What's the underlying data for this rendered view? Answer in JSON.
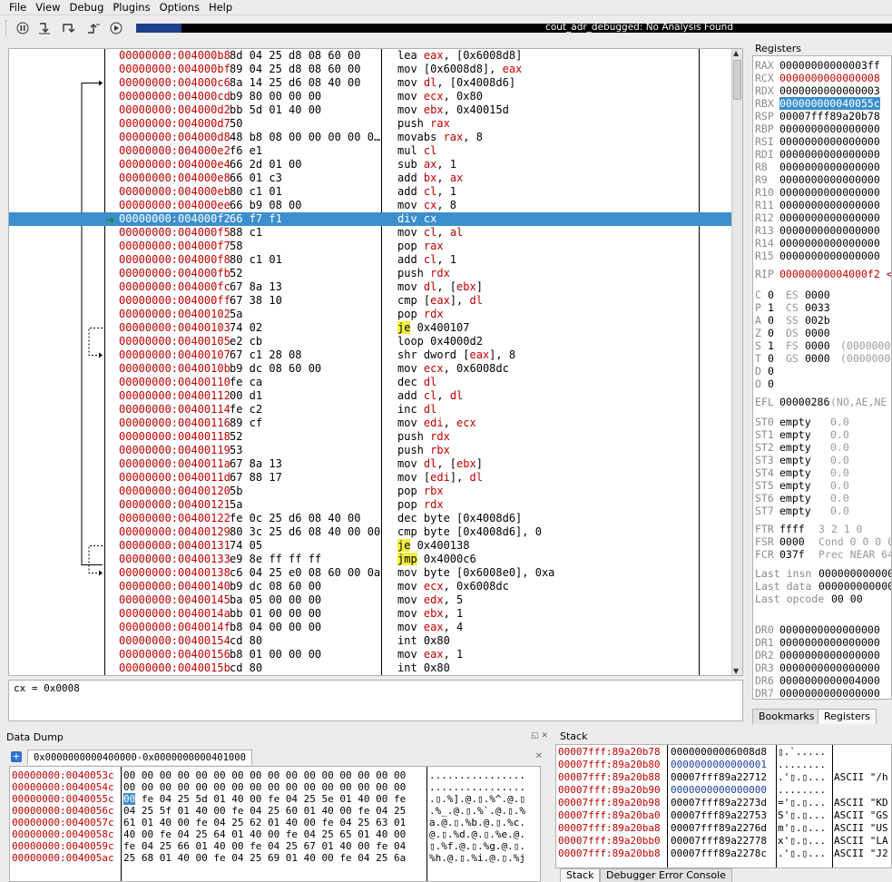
{
  "menu": [
    "File",
    "View",
    "Debug",
    "Plugins",
    "Options",
    "Help"
  ],
  "toolbar": {
    "icons": [
      "pause-icon",
      "step-into-icon",
      "step-over-icon",
      "step-out-icon",
      "run-icon"
    ]
  },
  "progress": {
    "text": "cout_adr_debugged: No Analysis Found",
    "fraction": 0.06
  },
  "disasm": [
    {
      "addr": "00000000:004000b8",
      "bytes": "8d 04 25 d8 08 60 00",
      "instr": [
        {
          "t": "lea "
        },
        {
          "t": "eax",
          "r": 1
        },
        {
          "t": ", [0x6008d8]"
        }
      ]
    },
    {
      "addr": "00000000:004000bf",
      "bytes": "89 04 25 d8 08 60 00",
      "instr": [
        {
          "t": "mov [0x6008d8], "
        },
        {
          "t": "eax",
          "r": 1
        }
      ]
    },
    {
      "addr": "00000000:004000c6",
      "bytes": "8a 14 25 d6 08 40 00",
      "instr": [
        {
          "t": "mov "
        },
        {
          "t": "dl",
          "r": 1
        },
        {
          "t": ", [0x4008d6]"
        }
      ]
    },
    {
      "addr": "00000000:004000cd",
      "bytes": "b9 80 00 00 00",
      "instr": [
        {
          "t": "mov "
        },
        {
          "t": "ecx",
          "r": 1
        },
        {
          "t": ", 0x80"
        }
      ]
    },
    {
      "addr": "00000000:004000d2",
      "bytes": "bb 5d 01 40 00",
      "instr": [
        {
          "t": "mov "
        },
        {
          "t": "ebx",
          "r": 1
        },
        {
          "t": ", 0x40015d"
        }
      ]
    },
    {
      "addr": "00000000:004000d7",
      "bytes": "50",
      "instr": [
        {
          "t": "push "
        },
        {
          "t": "rax",
          "r": 1
        }
      ]
    },
    {
      "addr": "00000000:004000d8",
      "bytes": "48 b8 08 00 00 00 00 0…",
      "instr": [
        {
          "t": "movabs "
        },
        {
          "t": "rax",
          "r": 1
        },
        {
          "t": ", 8"
        }
      ]
    },
    {
      "addr": "00000000:004000e2",
      "bytes": "f6 e1",
      "instr": [
        {
          "t": "mul "
        },
        {
          "t": "cl",
          "r": 1
        }
      ]
    },
    {
      "addr": "00000000:004000e4",
      "bytes": "66 2d 01 00",
      "instr": [
        {
          "t": "sub "
        },
        {
          "t": "ax",
          "r": 1
        },
        {
          "t": ", 1"
        }
      ]
    },
    {
      "addr": "00000000:004000e8",
      "bytes": "66 01 c3",
      "instr": [
        {
          "t": "add "
        },
        {
          "t": "bx",
          "r": 1
        },
        {
          "t": ", "
        },
        {
          "t": "ax",
          "r": 1
        }
      ]
    },
    {
      "addr": "00000000:004000eb",
      "bytes": "80 c1 01",
      "instr": [
        {
          "t": "add "
        },
        {
          "t": "cl",
          "r": 1
        },
        {
          "t": ", 1"
        }
      ]
    },
    {
      "addr": "00000000:004000ee",
      "bytes": "66 b9 08 00",
      "instr": [
        {
          "t": "mov "
        },
        {
          "t": "cx",
          "r": 1
        },
        {
          "t": ", 8"
        }
      ]
    },
    {
      "addr": "00000000:004000f2",
      "bytes": "66 f7 f1",
      "instr": [
        {
          "t": "div "
        },
        {
          "t": "cx",
          "r": 1
        }
      ],
      "sel": 1
    },
    {
      "addr": "00000000:004000f5",
      "bytes": "88 c1",
      "instr": [
        {
          "t": "mov "
        },
        {
          "t": "cl",
          "r": 1
        },
        {
          "t": ", "
        },
        {
          "t": "al",
          "r": 1
        }
      ]
    },
    {
      "addr": "00000000:004000f7",
      "bytes": "58",
      "instr": [
        {
          "t": "pop "
        },
        {
          "t": "rax",
          "r": 1
        }
      ]
    },
    {
      "addr": "00000000:004000f8",
      "bytes": "80 c1 01",
      "instr": [
        {
          "t": "add "
        },
        {
          "t": "cl",
          "r": 1
        },
        {
          "t": ", 1"
        }
      ]
    },
    {
      "addr": "00000000:004000fb",
      "bytes": "52",
      "instr": [
        {
          "t": "push "
        },
        {
          "t": "rdx",
          "r": 1
        }
      ]
    },
    {
      "addr": "00000000:004000fc",
      "bytes": "67 8a 13",
      "instr": [
        {
          "t": "mov "
        },
        {
          "t": "dl",
          "r": 1
        },
        {
          "t": ", ["
        },
        {
          "t": "ebx",
          "r": 1
        },
        {
          "t": "]"
        }
      ]
    },
    {
      "addr": "00000000:004000ff",
      "bytes": "67 38 10",
      "instr": [
        {
          "t": "cmp ["
        },
        {
          "t": "eax",
          "r": 1
        },
        {
          "t": "], "
        },
        {
          "t": "dl",
          "r": 1
        }
      ]
    },
    {
      "addr": "00000000:00400102",
      "bytes": "5a",
      "instr": [
        {
          "t": "pop "
        },
        {
          "t": "rdx",
          "r": 1
        }
      ]
    },
    {
      "addr": "00000000:00400103",
      "bytes": "74 02",
      "instr": [
        {
          "t": "je",
          "j": 1
        },
        {
          "t": " 0x400107"
        }
      ]
    },
    {
      "addr": "00000000:00400105",
      "bytes": "e2 cb",
      "instr": [
        {
          "t": "loop 0x4000d2"
        }
      ]
    },
    {
      "addr": "00000000:00400107",
      "bytes": "67 c1 28 08",
      "instr": [
        {
          "t": "shr dword ["
        },
        {
          "t": "eax",
          "r": 1
        },
        {
          "t": "], 8"
        }
      ]
    },
    {
      "addr": "00000000:0040010b",
      "bytes": "b9 dc 08 60 00",
      "instr": [
        {
          "t": "mov "
        },
        {
          "t": "ecx",
          "r": 1
        },
        {
          "t": ", 0x6008dc"
        }
      ]
    },
    {
      "addr": "00000000:00400110",
      "bytes": "fe ca",
      "instr": [
        {
          "t": "dec "
        },
        {
          "t": "dl",
          "r": 1
        }
      ]
    },
    {
      "addr": "00000000:00400112",
      "bytes": "00 d1",
      "instr": [
        {
          "t": "add "
        },
        {
          "t": "cl",
          "r": 1
        },
        {
          "t": ", "
        },
        {
          "t": "dl",
          "r": 1
        }
      ]
    },
    {
      "addr": "00000000:00400114",
      "bytes": "fe c2",
      "instr": [
        {
          "t": "inc "
        },
        {
          "t": "dl",
          "r": 1
        }
      ]
    },
    {
      "addr": "00000000:00400116",
      "bytes": "89 cf",
      "instr": [
        {
          "t": "mov "
        },
        {
          "t": "edi",
          "r": 1
        },
        {
          "t": ", "
        },
        {
          "t": "ecx",
          "r": 1
        }
      ]
    },
    {
      "addr": "00000000:00400118",
      "bytes": "52",
      "instr": [
        {
          "t": "push "
        },
        {
          "t": "rdx",
          "r": 1
        }
      ]
    },
    {
      "addr": "00000000:00400119",
      "bytes": "53",
      "instr": [
        {
          "t": "push "
        },
        {
          "t": "rbx",
          "r": 1
        }
      ]
    },
    {
      "addr": "00000000:0040011a",
      "bytes": "67 8a 13",
      "instr": [
        {
          "t": "mov "
        },
        {
          "t": "dl",
          "r": 1
        },
        {
          "t": ", ["
        },
        {
          "t": "ebx",
          "r": 1
        },
        {
          "t": "]"
        }
      ]
    },
    {
      "addr": "00000000:0040011d",
      "bytes": "67 88 17",
      "instr": [
        {
          "t": "mov ["
        },
        {
          "t": "edi",
          "r": 1
        },
        {
          "t": "], "
        },
        {
          "t": "dl",
          "r": 1
        }
      ]
    },
    {
      "addr": "00000000:00400120",
      "bytes": "5b",
      "instr": [
        {
          "t": "pop "
        },
        {
          "t": "rbx",
          "r": 1
        }
      ]
    },
    {
      "addr": "00000000:00400121",
      "bytes": "5a",
      "instr": [
        {
          "t": "pop "
        },
        {
          "t": "rdx",
          "r": 1
        }
      ]
    },
    {
      "addr": "00000000:00400122",
      "bytes": "fe 0c 25 d6 08 40 00",
      "instr": [
        {
          "t": "dec byte [0x4008d6]"
        }
      ]
    },
    {
      "addr": "00000000:00400129",
      "bytes": "80 3c 25 d6 08 40 00 00",
      "instr": [
        {
          "t": "cmp byte [0x4008d6], 0"
        }
      ]
    },
    {
      "addr": "00000000:00400131",
      "bytes": "74 05",
      "instr": [
        {
          "t": "je",
          "j": 1
        },
        {
          "t": " 0x400138"
        }
      ]
    },
    {
      "addr": "00000000:00400133",
      "bytes": "e9 8e ff ff ff",
      "instr": [
        {
          "t": "jmp",
          "j": 1
        },
        {
          "t": " 0x4000c6"
        }
      ]
    },
    {
      "addr": "00000000:00400138",
      "bytes": "c6 04 25 e0 08 60 00 0a",
      "instr": [
        {
          "t": "mov byte [0x6008e0], 0xa"
        }
      ]
    },
    {
      "addr": "00000000:00400140",
      "bytes": "b9 dc 08 60 00",
      "instr": [
        {
          "t": "mov "
        },
        {
          "t": "ecx",
          "r": 1
        },
        {
          "t": ", 0x6008dc"
        }
      ]
    },
    {
      "addr": "00000000:00400145",
      "bytes": "ba 05 00 00 00",
      "instr": [
        {
          "t": "mov "
        },
        {
          "t": "edx",
          "r": 1
        },
        {
          "t": ", 5"
        }
      ]
    },
    {
      "addr": "00000000:0040014a",
      "bytes": "bb 01 00 00 00",
      "instr": [
        {
          "t": "mov "
        },
        {
          "t": "ebx",
          "r": 1
        },
        {
          "t": ", 1"
        }
      ]
    },
    {
      "addr": "00000000:0040014f",
      "bytes": "b8 04 00 00 00",
      "instr": [
        {
          "t": "mov "
        },
        {
          "t": "eax",
          "r": 1
        },
        {
          "t": ", 4"
        }
      ]
    },
    {
      "addr": "00000000:00400154",
      "bytes": "cd 80",
      "instr": [
        {
          "t": "int 0x80"
        }
      ]
    },
    {
      "addr": "00000000:00400156",
      "bytes": "b8 01 00 00 00",
      "instr": [
        {
          "t": "mov "
        },
        {
          "t": "eax",
          "r": 1
        },
        {
          "t": ", 1"
        }
      ]
    },
    {
      "addr": "00000000:0040015b",
      "bytes": "cd 80",
      "instr": [
        {
          "t": "int 0x80"
        }
      ]
    }
  ],
  "status_text": "cx = 0x0008",
  "registers_title": "Registers",
  "registers": [
    {
      "n": "RAX",
      "v": "00000000000003ff"
    },
    {
      "n": "RCX",
      "v": "0000000000000008",
      "c": 1
    },
    {
      "n": "RDX",
      "v": "0000000000000003"
    },
    {
      "n": "RBX",
      "v": "000000000040055c",
      "hl": 1
    },
    {
      "n": "RSP",
      "v": "00007fff89a20b78"
    },
    {
      "n": "RBP",
      "v": "0000000000000000"
    },
    {
      "n": "RSI",
      "v": "0000000000000000"
    },
    {
      "n": "RDI",
      "v": "0000000000000000"
    },
    {
      "n": "R8",
      "v": "0000000000000000"
    },
    {
      "n": "R9",
      "v": "0000000000000000"
    },
    {
      "n": "R10",
      "v": "0000000000000000"
    },
    {
      "n": "R11",
      "v": "0000000000000000"
    },
    {
      "n": "R12",
      "v": "0000000000000000"
    },
    {
      "n": "R13",
      "v": "0000000000000000"
    },
    {
      "n": "R14",
      "v": "0000000000000000"
    },
    {
      "n": "R15",
      "v": "0000000000000000"
    }
  ],
  "rip": {
    "n": "RIP",
    "v": "00000000004000f2 <"
  },
  "flags": [
    {
      "f": "C",
      "v": "0",
      "s": "ES",
      "sv": "0000",
      "x": ""
    },
    {
      "f": "P",
      "v": "1",
      "s": "CS",
      "sv": "0033",
      "x": ""
    },
    {
      "f": "A",
      "v": "0",
      "s": "SS",
      "sv": "002b",
      "x": ""
    },
    {
      "f": "Z",
      "v": "0",
      "s": "DS",
      "sv": "0000",
      "x": ""
    },
    {
      "f": "S",
      "v": "1",
      "s": "FS",
      "sv": "0000",
      "x": "(00000000"
    },
    {
      "f": "T",
      "v": "0",
      "s": "GS",
      "sv": "0000",
      "x": "(00000000"
    },
    {
      "f": "D",
      "v": "0",
      "s": "",
      "sv": "",
      "x": ""
    },
    {
      "f": "O",
      "v": "0",
      "s": "",
      "sv": "",
      "x": ""
    }
  ],
  "efl": {
    "n": "EFL",
    "v": "00000286",
    "x": "(NO,AE,NE"
  },
  "fpu": [
    {
      "n": "ST0",
      "v": "empty",
      "x": "0.0"
    },
    {
      "n": "ST1",
      "v": "empty",
      "x": "0.0"
    },
    {
      "n": "ST2",
      "v": "empty",
      "x": "0.0"
    },
    {
      "n": "ST3",
      "v": "empty",
      "x": "0.0"
    },
    {
      "n": "ST4",
      "v": "empty",
      "x": "0.0"
    },
    {
      "n": "ST5",
      "v": "empty",
      "x": "0.0"
    },
    {
      "n": "ST6",
      "v": "empty",
      "x": "0.0"
    },
    {
      "n": "ST7",
      "v": "empty",
      "x": "0.0"
    }
  ],
  "fpu_ctrl": [
    {
      "n": "FTR",
      "v": "ffff",
      "x": "3 2 1 0"
    },
    {
      "n": "FSR",
      "v": "0000",
      "x": "Cond 0 0 0 0"
    },
    {
      "n": "FCR",
      "v": "037f",
      "x": "Prec NEAR 64"
    }
  ],
  "last": [
    {
      "n": "Last insn",
      "v": "000000000000"
    },
    {
      "n": "Last data",
      "v": "000000000000"
    },
    {
      "n": "Last opcode",
      "v": "00 00"
    }
  ],
  "dregs": [
    {
      "n": "DR0",
      "v": "0000000000000000"
    },
    {
      "n": "DR1",
      "v": "0000000000000000"
    },
    {
      "n": "DR2",
      "v": "0000000000000000"
    },
    {
      "n": "DR3",
      "v": "0000000000000000"
    },
    {
      "n": "DR6",
      "v": "0000000000004000"
    },
    {
      "n": "DR7",
      "v": "0000000000000000"
    }
  ],
  "reg_tabs": [
    "Bookmarks",
    "Registers"
  ],
  "dump_title": "Data Dump",
  "dump_tab": "0x0000000000400000-0x0000000000401000",
  "dump": [
    {
      "a": "00000000:0040053c",
      "h": "00 00 00 00 00 00 00 00 00 00 00 00 00 00 00 00",
      "c": "................"
    },
    {
      "a": "00000000:0040054c",
      "h": "00 00 00 00 00 00 00 00 00 00 00 00 00 00 00 00",
      "c": "................"
    },
    {
      "a": "00000000:0040055c",
      "h": "00 fe 04 25 5d 01 40 00 fe 04 25 5e 01 40 00 fe",
      "c": ".▯.%].@.▯.%^.@.▯",
      "sel": 1
    },
    {
      "a": "00000000:0040056c",
      "h": "04 25 5f 01 40 00 fe 04 25 60 01 40 00 fe 04 25",
      "c": ".%_.@.▯.%`.@.▯.%"
    },
    {
      "a": "00000000:0040057c",
      "h": "61 01 40 00 fe 04 25 62 01 40 00 fe 04 25 63 01",
      "c": "a.@.▯.%b.@.▯.%c."
    },
    {
      "a": "00000000:0040058c",
      "h": "40 00 fe 04 25 64 01 40 00 fe 04 25 65 01 40 00",
      "c": "@.▯.%d.@.▯.%e.@."
    },
    {
      "a": "00000000:0040059c",
      "h": "fe 04 25 66 01 40 00 fe 04 25 67 01 40 00 fe 04",
      "c": "▯.%f.@.▯.%g.@.▯."
    },
    {
      "a": "00000000:004005ac",
      "h": "25 68 01 40 00 fe 04 25 69 01 40 00 fe 04 25 6a",
      "c": "%h.@.▯.%i.@.▯.%j"
    }
  ],
  "stack_title": "Stack",
  "stack": [
    {
      "a": "00007fff:89a20b78",
      "v": "00000000006008d8",
      "s": "▯.`.....",
      "t": ""
    },
    {
      "a": "00007fff:89a20b80",
      "v": "0000000000000001",
      "s": "........",
      "t": "",
      "blue": 1
    },
    {
      "a": "00007fff:89a20b88",
      "v": "00007fff89a22712",
      "s": ".'▯.▯...",
      "t": "ASCII \"/h"
    },
    {
      "a": "00007fff:89a20b90",
      "v": "0000000000000000",
      "s": "........",
      "t": "",
      "blue": 1
    },
    {
      "a": "00007fff:89a20b98",
      "v": "00007fff89a2273d",
      "s": "='▯.▯...",
      "t": "ASCII \"KD"
    },
    {
      "a": "00007fff:89a20ba0",
      "v": "00007fff89a22753",
      "s": "S'▯.▯...",
      "t": "ASCII \"GS"
    },
    {
      "a": "00007fff:89a20ba8",
      "v": "00007fff89a2276d",
      "s": "m'▯.▯...",
      "t": "ASCII \"US"
    },
    {
      "a": "00007fff:89a20bb0",
      "v": "00007fff89a22778",
      "s": "x'▯.▯...",
      "t": "ASCII \"LA"
    },
    {
      "a": "00007fff:89a20bb8",
      "v": "00007fff89a2278c",
      "s": ".'▯.▯...",
      "t": "ASCII \"J2"
    }
  ],
  "stack_tabs": [
    "Stack",
    "Debugger Error Console"
  ],
  "colors": {
    "selection": "#3b8fce",
    "address": "#c00000",
    "jump": "#f2ef3a"
  }
}
